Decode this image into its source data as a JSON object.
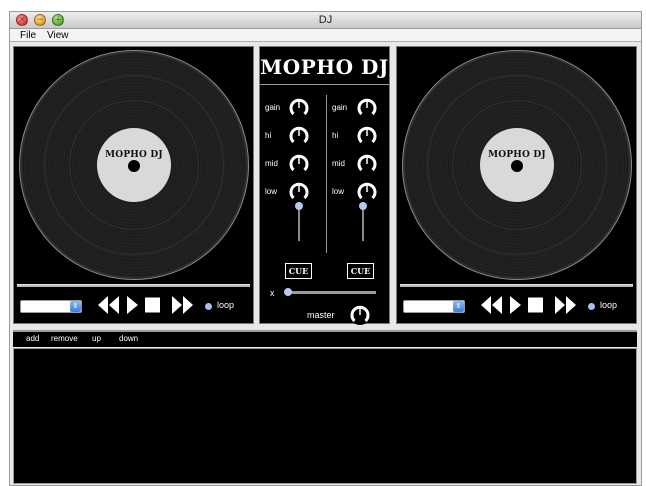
{
  "window": {
    "title": "DJ"
  },
  "menu": {
    "items": [
      "File",
      "View"
    ]
  },
  "mixer": {
    "logo": "MOPHO DJ",
    "knob_labels": {
      "gain": "gain",
      "hi": "hi",
      "mid": "mid",
      "low": "low"
    },
    "cue_label": "CUE",
    "crossfader_label": "x",
    "crossfader_level": 0.0,
    "master_label": "master",
    "left_channel_fader_level": 1.0,
    "right_channel_fader_level": 1.0
  },
  "decks": [
    {
      "record_label": "MOPHO DJ",
      "track_select_value": "",
      "loop_label": "loop",
      "loop_on": false
    },
    {
      "record_label": "MOPHO DJ",
      "track_select_value": "",
      "loop_label": "loop",
      "loop_on": false
    }
  ],
  "playlist": {
    "buttons": {
      "add": "add",
      "remove": "remove",
      "up": "up",
      "down": "down"
    },
    "items": []
  },
  "colors": {
    "panel_background": "#000000",
    "window_background": "#e8e8e8",
    "accent_blue": "#b8c8ee",
    "record_label": "#d9d9d9"
  },
  "icons": {
    "rewind": "rewind-icon",
    "play": "play-icon",
    "stop": "stop-icon",
    "fast_forward": "fast-forward-icon",
    "select_arrows": "updown-arrows-icon"
  }
}
